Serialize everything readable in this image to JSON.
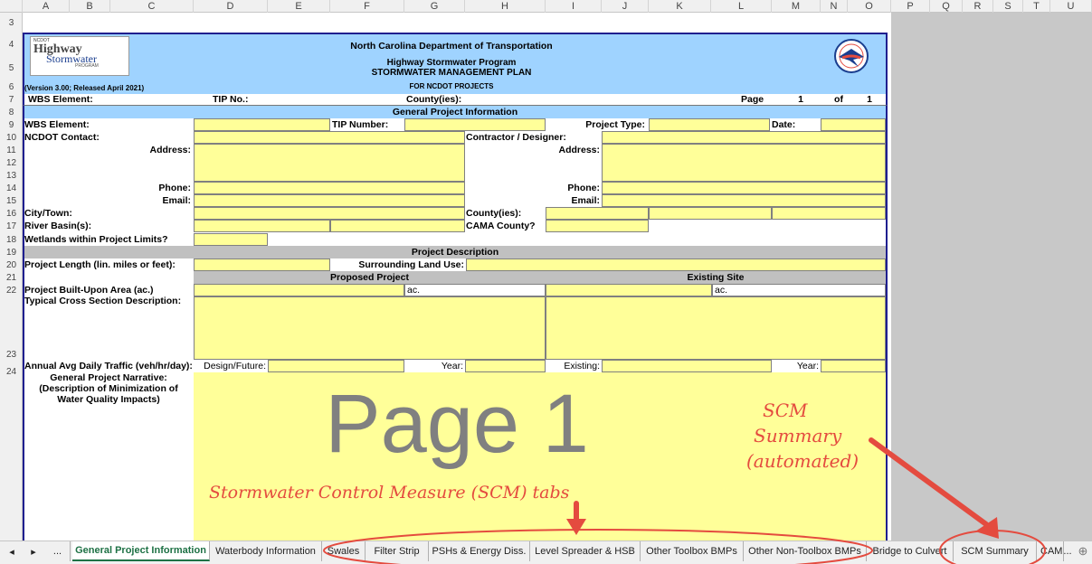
{
  "columns": [
    "A",
    "B",
    "C",
    "D",
    "E",
    "F",
    "G",
    "H",
    "I",
    "J",
    "K",
    "L",
    "M",
    "N",
    "O",
    "P",
    "Q",
    "R",
    "S",
    "T",
    "U"
  ],
  "rows": [
    "3",
    "4",
    "5",
    "6",
    "7",
    "8",
    "9",
    "10",
    "11",
    "12",
    "13",
    "14",
    "15",
    "16",
    "17",
    "18",
    "19",
    "20",
    "21",
    "22",
    "23",
    "24"
  ],
  "logo": {
    "line1": "NCDOT",
    "line2": "Highway",
    "line3": "Stormwater",
    "line4": "PROGRAM"
  },
  "header": {
    "org": "North Carolina Department of Transportation",
    "program": "Highway Stormwater Program",
    "plan": "STORMWATER MANAGEMENT PLAN",
    "for": "FOR NCDOT PROJECTS",
    "version": "(Version 3.00; Released April 2021)"
  },
  "row7": {
    "wbs": "WBS Element:",
    "tip": "TIP No.:",
    "county": "County(ies):",
    "page": "Page",
    "page_num": "1",
    "of": "of",
    "of_num": "1"
  },
  "gpi_title": "General Project Information",
  "labels": {
    "wbs": "WBS Element:",
    "tip": "TIP Number:",
    "ptype": "Project Type:",
    "date": "Date:",
    "contact": "NCDOT Contact:",
    "contractor": "Contractor / Designer:",
    "address": "Address:",
    "address2": "Address:",
    "phone": "Phone:",
    "phone2": "Phone:",
    "email": "Email:",
    "email2": "Email:",
    "city": "City/Town:",
    "county": "County(ies):",
    "river": "River Basin(s):",
    "cama": "CAMA County?",
    "wetlands": "Wetlands within Project Limits?"
  },
  "pd_title": "Project Description",
  "pd": {
    "length": "Project Length (lin. miles or feet):",
    "landuse": "Surrounding Land Use:",
    "proposed": "Proposed Project",
    "existing": "Existing Site",
    "bua": "Project Built-Upon Area (ac.)",
    "ac1": "ac.",
    "ac2": "ac.",
    "tcs": "Typical Cross Section Description:",
    "aadt": "Annual Avg Daily Traffic (veh/hr/day):",
    "design": "Design/Future:",
    "year": "Year:",
    "exist": "Existing:",
    "year2": "Year:",
    "narrative": "General Project Narrative: (Description of Minimization of Water Quality Impacts)"
  },
  "watermark": "Page 1",
  "annotations": {
    "scm_tabs": "Stormwater Control Measure (SCM) tabs",
    "scm_summary_1": "SCM",
    "scm_summary_2": "Summary",
    "scm_summary_3": "(automated)"
  },
  "tabs": [
    {
      "label": "General Project Information"
    },
    {
      "label": "Waterbody Information"
    },
    {
      "label": "Swales"
    },
    {
      "label": "Filter Strip"
    },
    {
      "label": "PSHs & Energy Diss."
    },
    {
      "label": "Level Spreader & HSB"
    },
    {
      "label": "Other Toolbox BMPs"
    },
    {
      "label": "Other Non-Toolbox BMPs"
    },
    {
      "label": "Bridge to Culvert"
    },
    {
      "label": "SCM Summary"
    },
    {
      "label": "CAM"
    }
  ],
  "nav": {
    "prev": "◂",
    "next": "▸",
    "more": "...",
    "more2": "...",
    "add": "⊕"
  },
  "colors": {
    "annotation": "#e44b3f",
    "blue": "#9fd3ff",
    "yellow": "#ffff99",
    "grey": "#c0c0c0",
    "active_tab": "#1e7145"
  }
}
